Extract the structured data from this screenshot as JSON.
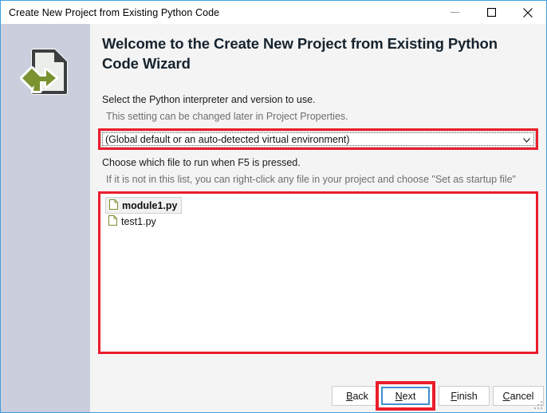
{
  "window": {
    "title": "Create New Project from Existing Python Code",
    "controls": {
      "minimize": "minimize-icon",
      "maximize": "maximize-icon",
      "close": "close-icon"
    }
  },
  "wizard": {
    "icon_name": "python-import-document-icon",
    "heading": "Welcome to the Create New Project from Existing Python Code Wizard",
    "interpreter_section": {
      "prompt": "Select the Python interpreter and version to use.",
      "hint": "This setting can be changed later in Project Properties.",
      "combo": {
        "selected": "(Global default or an auto-detected virtual environment)",
        "arrow_icon": "chevron-down-icon"
      }
    },
    "startup_section": {
      "prompt": "Choose which file to run when F5 is pressed.",
      "hint": "If it is not in this list, you can right-click any file in your project and choose \"Set as startup file\"",
      "files": [
        {
          "name": "module1.py",
          "selected": true,
          "icon": "python-file-icon"
        },
        {
          "name": "test1.py",
          "selected": false,
          "icon": "python-file-icon"
        }
      ]
    }
  },
  "footer": {
    "buttons": [
      {
        "id": "back",
        "label": "Back",
        "mnemonic": "B",
        "focused": false,
        "highlighted": false
      },
      {
        "id": "next",
        "label": "Next",
        "mnemonic": "N",
        "focused": true,
        "highlighted": true
      },
      {
        "id": "finish",
        "label": "Finish",
        "mnemonic": "F",
        "focused": false,
        "highlighted": false
      },
      {
        "id": "cancel",
        "label": "Cancel",
        "mnemonic": "C",
        "focused": false,
        "highlighted": false
      }
    ]
  },
  "colors": {
    "window_border": "#3f9ee0",
    "sidebar": "#cbcfdd",
    "body": "#f4f4f4",
    "annotation_red": "#ea1d2c",
    "focus_blue": "#3f8fd0",
    "heading_text": "#16232e",
    "hint_text": "#6e6e6e",
    "file_icon_green": "#7a922f"
  }
}
